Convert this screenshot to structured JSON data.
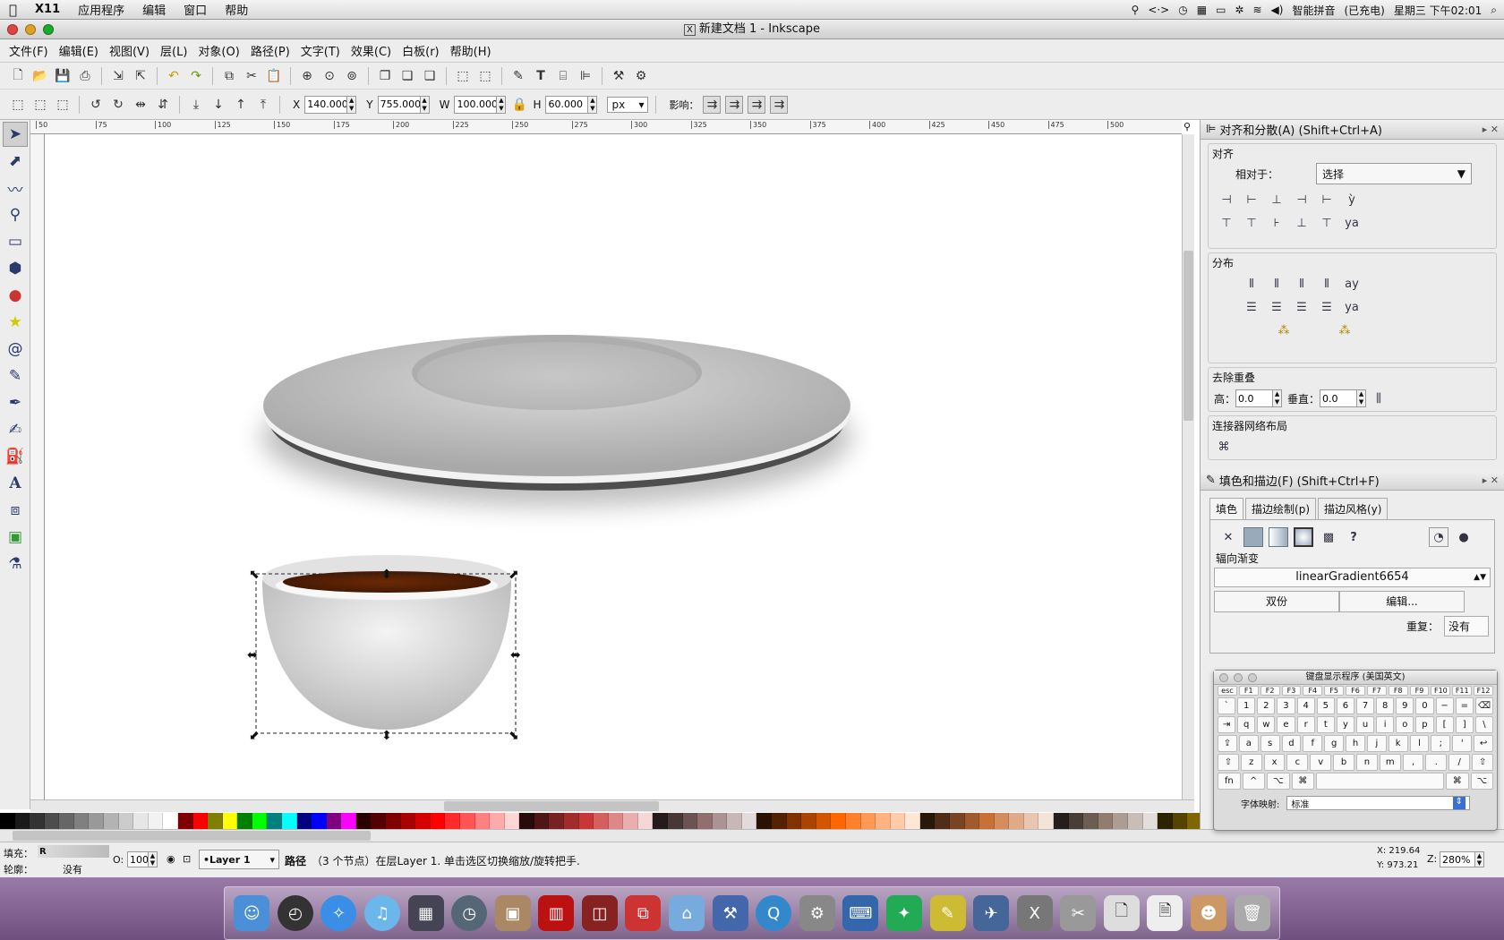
{
  "mac_menubar": {
    "app": "X11",
    "items": [
      "应用程序",
      "编辑",
      "窗口",
      "帮助"
    ],
    "ime": "智能拼音",
    "battery": "(已充电)",
    "clock": "星期三 下午02:01"
  },
  "window": {
    "title": "新建文档 1 - Inkscape"
  },
  "menu": [
    "文件(F)",
    "编辑(E)",
    "视图(V)",
    "层(L)",
    "对象(O)",
    "路径(P)",
    "文字(T)",
    "效果(C)",
    "白板(r)",
    "帮助(H)"
  ],
  "tool_controls": {
    "x_label": "X",
    "x": "140.000",
    "y_label": "Y",
    "y": "755.000",
    "w_label": "W",
    "w": "100.000",
    "h_label": "H",
    "h": "60.000",
    "unit": "px",
    "affect_label": "影响："
  },
  "ruler_ticks": [
    "50",
    "75",
    "100",
    "125",
    "150",
    "175",
    "200",
    "225",
    "250",
    "275",
    "300",
    "325",
    "350",
    "375",
    "400",
    "425",
    "450",
    "475",
    "500"
  ],
  "align_panel": {
    "title": "对齐和分散(A) (Shift+Ctrl+A)",
    "align_label": "对齐",
    "relative_label": "相对于：",
    "relative_value": "选择",
    "distribute_label": "分布",
    "remove_overlap_label": "去除重叠",
    "h_label": "高：",
    "h_value": "0.0",
    "v_label": "垂直：",
    "v_value": "0.0",
    "connector_label": "连接器网络布局"
  },
  "fill_panel": {
    "title": "填色和描边(F) (Shift+Ctrl+F)",
    "tabs": [
      "填色",
      "描边绘制(p)",
      "描边风格(y)"
    ],
    "gradient_type": "辐向渐变",
    "gradient_name": "linearGradient6654",
    "duplicate": "双份",
    "edit": "编辑...",
    "repeat_label": "重复：",
    "repeat_value": "没有"
  },
  "keyboard": {
    "title": "键盘显示程序 (美国英文)",
    "font_label": "字体映射:",
    "font_value": "标准",
    "fkeys": [
      "esc",
      "F1",
      "F2",
      "F3",
      "F4",
      "F5",
      "F6",
      "F7",
      "F8",
      "F9",
      "F10",
      "F11",
      "F12"
    ],
    "row1": [
      "`",
      "1",
      "2",
      "3",
      "4",
      "5",
      "6",
      "7",
      "8",
      "9",
      "0",
      "−",
      "=",
      "⌫"
    ],
    "row2": [
      "⇥",
      "q",
      "w",
      "e",
      "r",
      "t",
      "y",
      "u",
      "i",
      "o",
      "p",
      "[",
      "]",
      "\\"
    ],
    "row3": [
      "⇪",
      "a",
      "s",
      "d",
      "f",
      "g",
      "h",
      "j",
      "k",
      "l",
      ";",
      "'",
      "↩"
    ],
    "row4": [
      "⇧",
      "z",
      "x",
      "c",
      "v",
      "b",
      "n",
      "m",
      ",",
      ".",
      "/",
      "⇧"
    ],
    "row5": [
      "fn",
      "^",
      "⌥",
      "⌘",
      "",
      "⌘",
      "⌥"
    ]
  },
  "status": {
    "fill_label": "填充：",
    "fill_value": "R",
    "stroke_label": "轮廓：",
    "stroke_value": "没有",
    "opacity_label": "O:",
    "opacity": "100",
    "layer": "•Layer 1",
    "message_bold": "路径",
    "message": "（3 个节点）在层Layer 1. 单击选区切换缩放/旋转把手.",
    "x_coord": "X: 219.64",
    "y_coord": "Y: 973.21",
    "zoom_label": "Z:",
    "zoom": "280%"
  },
  "palette": [
    "#000",
    "#1a1a1a",
    "#333",
    "#4d4d4d",
    "#666",
    "#808080",
    "#999",
    "#b3b3b3",
    "#ccc",
    "#e6e6e6",
    "#f2f2f2",
    "#fff",
    "#800000",
    "#f00",
    "#808000",
    "#ff0",
    "#008000",
    "#0f0",
    "#008080",
    "#0ff",
    "#000080",
    "#00f",
    "#800080",
    "#f0f",
    "#2b0000",
    "#550000",
    "#800000",
    "#aa0000",
    "#d40000",
    "#f00",
    "#ff2a2a",
    "#f55",
    "#ff8080",
    "#faa",
    "#ffd5d5",
    "#280b0b",
    "#501616",
    "#782121",
    "#a02c2c",
    "#c83737",
    "#d35f5f",
    "#de8787",
    "#e9afaf",
    "#f4d7d7",
    "#241c1c",
    "#483737",
    "#6c5353",
    "#916f6f",
    "#ac9393",
    "#c8b7b7",
    "#e3dbdb",
    "#2b1100",
    "#552200",
    "#803300",
    "#a40",
    "#d45500",
    "#f60",
    "#ff7f2a",
    "#f95",
    "#ffb380",
    "#fca",
    "#ffe6d5",
    "#28170b",
    "#502d16",
    "#784421",
    "#a05a2c",
    "#c87137",
    "#d38d5f",
    "#deaa87",
    "#e9c6af",
    "#f4e3d7",
    "#241f1c",
    "#483e37",
    "#6c5d53",
    "#917c6f",
    "#ac9d93",
    "#c8beb7",
    "#e3dedb",
    "#2b2200",
    "#554400",
    "#806600",
    "#a80"
  ]
}
